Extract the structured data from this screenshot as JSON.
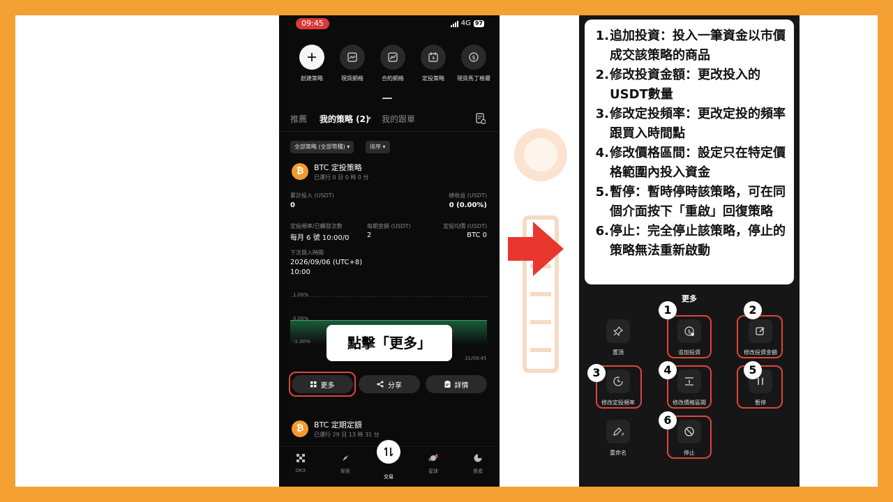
{
  "colors": {
    "frame": "#f5a033",
    "accent_red": "#e0453c",
    "btc_orange": "#f29a2e",
    "chart_green": "#2fa870"
  },
  "status": {
    "time": "09:45",
    "network": "4G",
    "battery": "97"
  },
  "strategies": [
    {
      "label": "創建策略",
      "icon": "plus-icon"
    },
    {
      "label": "現貨網格",
      "icon": "grid-chart-icon"
    },
    {
      "label": "合約網格",
      "icon": "contract-grid-icon"
    },
    {
      "label": "定投策略",
      "icon": "calendar-icon"
    },
    {
      "label": "現貨馬丁格爾",
      "icon": "coin-icon"
    }
  ],
  "tabs": {
    "recommend": "推薦",
    "my_strategies": "我的策略 (2)",
    "my_copy": "我的跟單"
  },
  "filters": {
    "all": "全部策略 (全部幣種)",
    "sort": "排序"
  },
  "card1": {
    "coin": "₿",
    "title": "BTC 定投策略",
    "runtime": "已運行 0 日 0 時 0 分",
    "invested_label": "累計投入 (USDT)",
    "invested_value": "0",
    "pnl_label": "總收益 (USDT)",
    "pnl_value": "0 (0.00%)",
    "freq_label": "定投頻率/已觸發次數",
    "freq_value": "每月 6 號 10:00/0",
    "amount_label": "每期金額 (USDT)",
    "amount_value": "2",
    "avg_label": "定投均價 (USDT)",
    "avg_value": "BTC 0",
    "next_label": "下次買入時間",
    "next_date": "2026/09/06 (UTC+8)",
    "next_time": "10:00"
  },
  "chart": {
    "top": "1.00%",
    "mid": "0.00%",
    "bottom": "-1.00%",
    "xlabel": "31/09:45"
  },
  "callout": "點擊「更多」",
  "actions": {
    "more": "更多",
    "share": "分享",
    "detail": "詳情"
  },
  "card2": {
    "coin": "₿",
    "title": "BTC 定期定額",
    "runtime": "已運行 29 日 13 時 31 分"
  },
  "bottom_nav": {
    "okx": "OKX",
    "explore": "探索",
    "trade": "交易",
    "planet": "星球",
    "assets": "資產"
  },
  "instructions": [
    {
      "num": "1.",
      "text": "追加投資：投入一筆資金以市價成交該策略的商品"
    },
    {
      "num": "2.",
      "text": "修改投資金額：更改投入的USDT數量"
    },
    {
      "num": "3.",
      "text": "修改定投頻率：更改定投的頻率跟買入時間點"
    },
    {
      "num": "4.",
      "text": "修改價格區間：設定只在特定價格範圍內投入資金"
    },
    {
      "num": "5.",
      "text": "暫停：暫時停時該策略，可在同個介面按下「重啟」回復策略"
    },
    {
      "num": "6.",
      "text": "停止：完全停止該策略，停止的策略無法重新啟動"
    }
  ],
  "more_menu": {
    "title": "更多",
    "pin": "置頂",
    "add_invest": "追加投資",
    "edit_amount": "修改投資金額",
    "edit_freq": "修改定投頻率",
    "edit_range": "修改價格區間",
    "pause": "暫停",
    "rename": "重命名",
    "stop": "停止"
  },
  "badges": [
    "1",
    "2",
    "3",
    "4",
    "5",
    "6"
  ]
}
